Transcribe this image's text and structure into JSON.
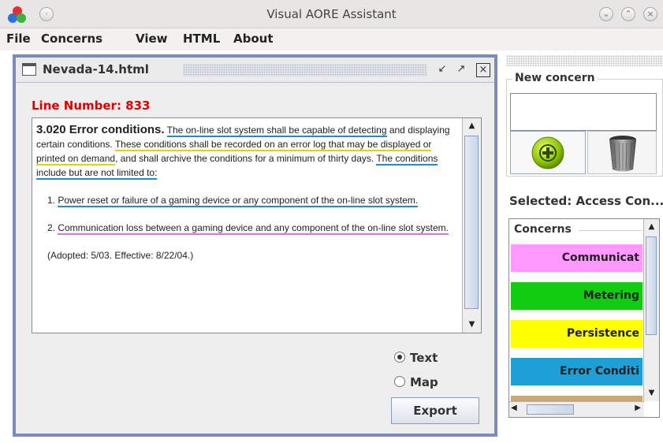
{
  "window": {
    "title": "Visual AORE Assistant"
  },
  "menu": [
    "File",
    "Concerns",
    "View",
    "HTML",
    "About"
  ],
  "frame": {
    "title": "Nevada-14.html"
  },
  "line_number": "Line Number: 833",
  "document": {
    "heading": "3.020 Error conditions.",
    "p1": [
      {
        "text": "The on-line slot system shall be capable of detecting",
        "u": "blue"
      },
      {
        "text": " and displaying certain conditions. ",
        "u": ""
      },
      {
        "text": "These conditions shall be recorded on an error log that may be displayed or printed on demand",
        "u": "yellow"
      },
      {
        "text": ", and shall archive the conditions for a minimum of thirty days. ",
        "u": ""
      },
      {
        "text": "The conditions include but are not limited to:",
        "u": "blue"
      }
    ],
    "item1_num": "1. ",
    "item1": "Power reset or failure of a gaming device or any component of the on-line slot system.",
    "item2_num": "2. ",
    "item2": "Communication loss between a gaming device and any component of the on-line slot system.",
    "footer": "(Adopted: 5/03. Effective: 8/22/04.)"
  },
  "view_mode": {
    "text_label": "Text",
    "map_label": "Map",
    "selected": "Text"
  },
  "export_label": "Export",
  "right_panel": {
    "new_concern_label": "New concern",
    "new_concern_value": "",
    "selected_label": "Selected: Access Con...",
    "concerns_title": "Concerns",
    "concerns": [
      {
        "label": "Communicat",
        "color": "#ff99ff"
      },
      {
        "label": "Metering",
        "color": "#11cc11"
      },
      {
        "label": "Persistence",
        "color": "#ffff00"
      },
      {
        "label": "Error Conditi",
        "color": "#1e9fd6"
      },
      {
        "label": "",
        "color": "#c8a878"
      }
    ]
  },
  "colors": {
    "underline_blue": "#1a8ed1",
    "underline_yellow": "#e5d300",
    "underline_pink": "#e070e0",
    "line_number": "#e00000",
    "frame_border": "#7c8cb9"
  }
}
